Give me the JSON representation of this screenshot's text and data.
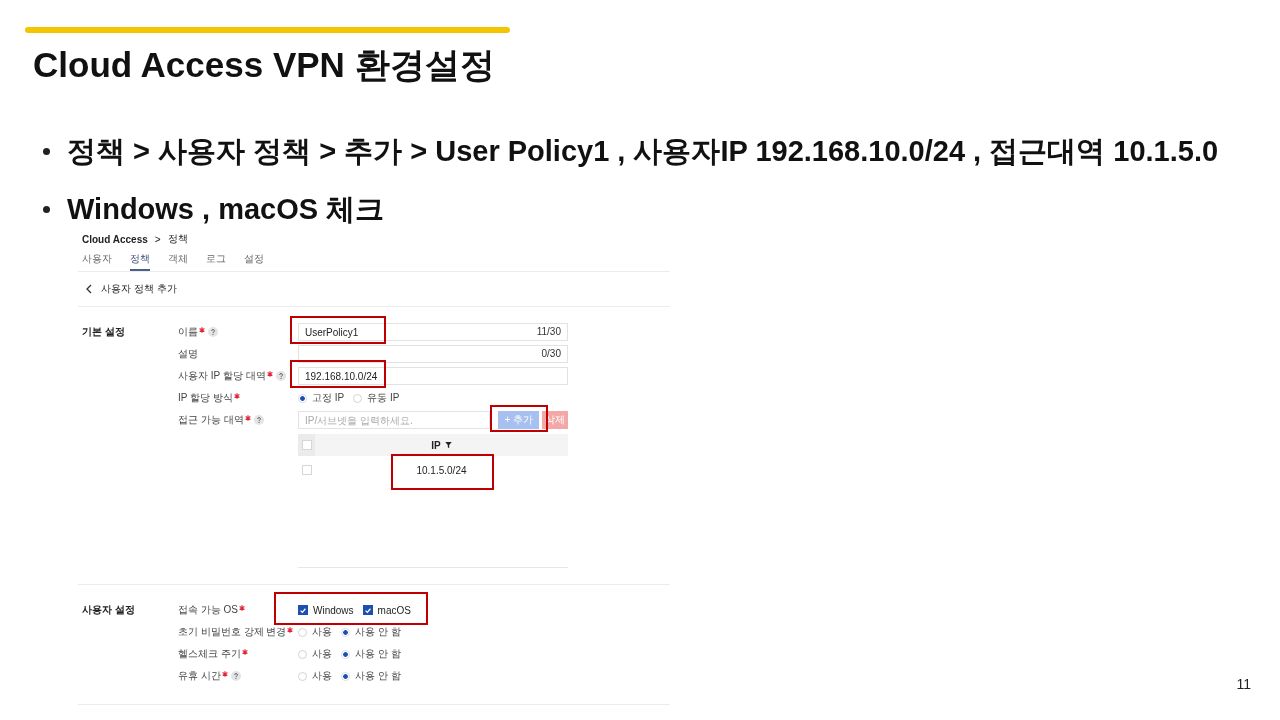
{
  "slide": {
    "title": "Cloud Access VPN 환경설정",
    "page_number": "11"
  },
  "bullets": [
    "정책 > 사용자 정책 > 추가 > User Policy1 , 사용자IP 192.168.10.0/24 , 접근대역 10.1.5.0",
    "Windows , macOS 체크"
  ],
  "screenshot": {
    "breadcrumb": {
      "items": [
        "Cloud Access",
        "정책"
      ],
      "separator": ">"
    },
    "tabs": [
      {
        "label": "사용자",
        "selected": false
      },
      {
        "label": "정책",
        "selected": true
      },
      {
        "label": "객체",
        "selected": false
      },
      {
        "label": "로그",
        "selected": false
      },
      {
        "label": "설정",
        "selected": false
      }
    ],
    "page_header": {
      "title": "사용자 정책 추가"
    },
    "sections": [
      {
        "title": "기본 설정",
        "rows": [
          {
            "kind": "text",
            "label": "이름",
            "required": true,
            "help": true,
            "value": "UserPolicy1",
            "counter": "11/30",
            "highlighted": true
          },
          {
            "kind": "text",
            "label": "설명",
            "required": false,
            "help": false,
            "counter": "0/30",
            "highlighted": false
          },
          {
            "kind": "text",
            "label": "사용자 IP 할당 대역",
            "required": true,
            "help": true,
            "value": "192.168.10.0/24",
            "highlighted": true
          },
          {
            "kind": "radio",
            "label": "IP 할당 방식",
            "required": true,
            "help": false,
            "options": [
              {
                "label": "고정 IP",
                "selected": true
              },
              {
                "label": "유동 IP",
                "selected": false
              }
            ]
          },
          {
            "kind": "list",
            "label": "접근 가능 대역",
            "required": true,
            "help": true,
            "placeholder": "IP/서브넷을 입력하세요.",
            "buttons": [
              {
                "kind": "add",
                "label": "+ 추가",
                "highlighted": true
              },
              {
                "kind": "delete",
                "label": "삭제",
                "highlighted": false
              }
            ],
            "table": {
              "select_all_checked": false,
              "columns": [
                {
                  "label": "IP",
                  "filter": true
                }
              ],
              "rows": [
                {
                  "checked": false,
                  "highlighted": true,
                  "cells": [
                    "10.1.5.0/24"
                  ]
                }
              ]
            }
          }
        ]
      },
      {
        "title": "사용자 설정",
        "rows": [
          {
            "kind": "checks",
            "label": "접속 가능 OS",
            "required": true,
            "help": false,
            "highlighted": true,
            "options": [
              {
                "label": "Windows",
                "checked": true
              },
              {
                "label": "macOS",
                "checked": true
              }
            ]
          },
          {
            "kind": "radio",
            "label": "초기 비밀번호 강제 변경",
            "required": true,
            "help": false,
            "options": [
              {
                "label": "사용",
                "selected": false
              },
              {
                "label": "사용 안 함",
                "selected": true
              }
            ]
          },
          {
            "kind": "radio",
            "label": "헬스체크 주기",
            "required": true,
            "help": false,
            "options": [
              {
                "label": "사용",
                "selected": false
              },
              {
                "label": "사용 안 함",
                "selected": true
              }
            ]
          },
          {
            "kind": "radio",
            "label": "유휴 시간",
            "required": true,
            "help": true,
            "options": [
              {
                "label": "사용",
                "selected": false
              },
              {
                "label": "사용 안 함",
                "selected": true
              }
            ]
          }
        ]
      }
    ]
  }
}
